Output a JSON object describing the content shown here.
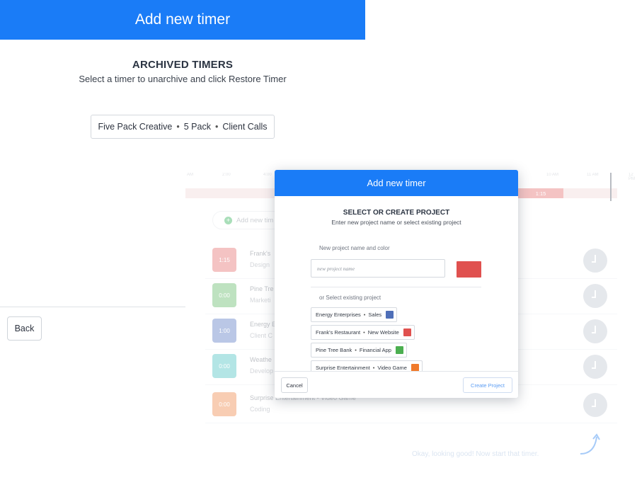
{
  "header": {
    "title": "Add new timer"
  },
  "archived": {
    "title": "ARCHIVED TIMERS",
    "subtitle": "Select a timer to unarchive and click Restore Timer",
    "items": [
      {
        "client": "Five Pack Creative",
        "project": "5 Pack",
        "task": "Client Calls"
      }
    ]
  },
  "back_button": "Back",
  "background": {
    "timeline": {
      "ticks": [
        "AM",
        "2:00",
        "4:00",
        "10 AM",
        "11 AM",
        "12 PM"
      ],
      "chip": "1:15"
    },
    "add_timer": "Add new tim",
    "timers": [
      {
        "time": "1:15",
        "client": "Frank's",
        "task": "Design",
        "color": "#e57373"
      },
      {
        "time": "0:00",
        "client": "Pine Tre",
        "task": "Marketi",
        "color": "#66bb6a"
      },
      {
        "time": "1:00",
        "client": "Energy E",
        "task": "Client C",
        "color": "#5c7cc4"
      },
      {
        "time": "0:00",
        "client": "Weathe",
        "task": "Develop",
        "color": "#4dc3c3"
      },
      {
        "time": "0:00",
        "client": "Surprise Entertainment  •  Video Game",
        "task": "Coding",
        "color": "#f08a4b"
      }
    ],
    "hint": "Okay, looking good! Now start that timer."
  },
  "modal": {
    "title": "Add new timer",
    "heading": "SELECT OR CREATE PROJECT",
    "subheading": "Enter new project name or select existing project",
    "new_project_label": "New project name and color",
    "new_project_placeholder": "new project name",
    "new_project_color": "#e0514f",
    "existing_label": "or Select existing project",
    "projects": [
      {
        "client": "Energy Enterprises",
        "project": "Sales",
        "color": "#4f6fb8"
      },
      {
        "client": "Frank's Restaurant",
        "project": "New Website",
        "color": "#e0514f"
      },
      {
        "client": "Pine Tree Bank",
        "project": "Financial App",
        "color": "#4caf50"
      },
      {
        "client": "Surprise Entertainment",
        "project": "Video Game",
        "color": "#f07a2b"
      }
    ],
    "cancel": "Cancel",
    "create": "Create Project"
  }
}
